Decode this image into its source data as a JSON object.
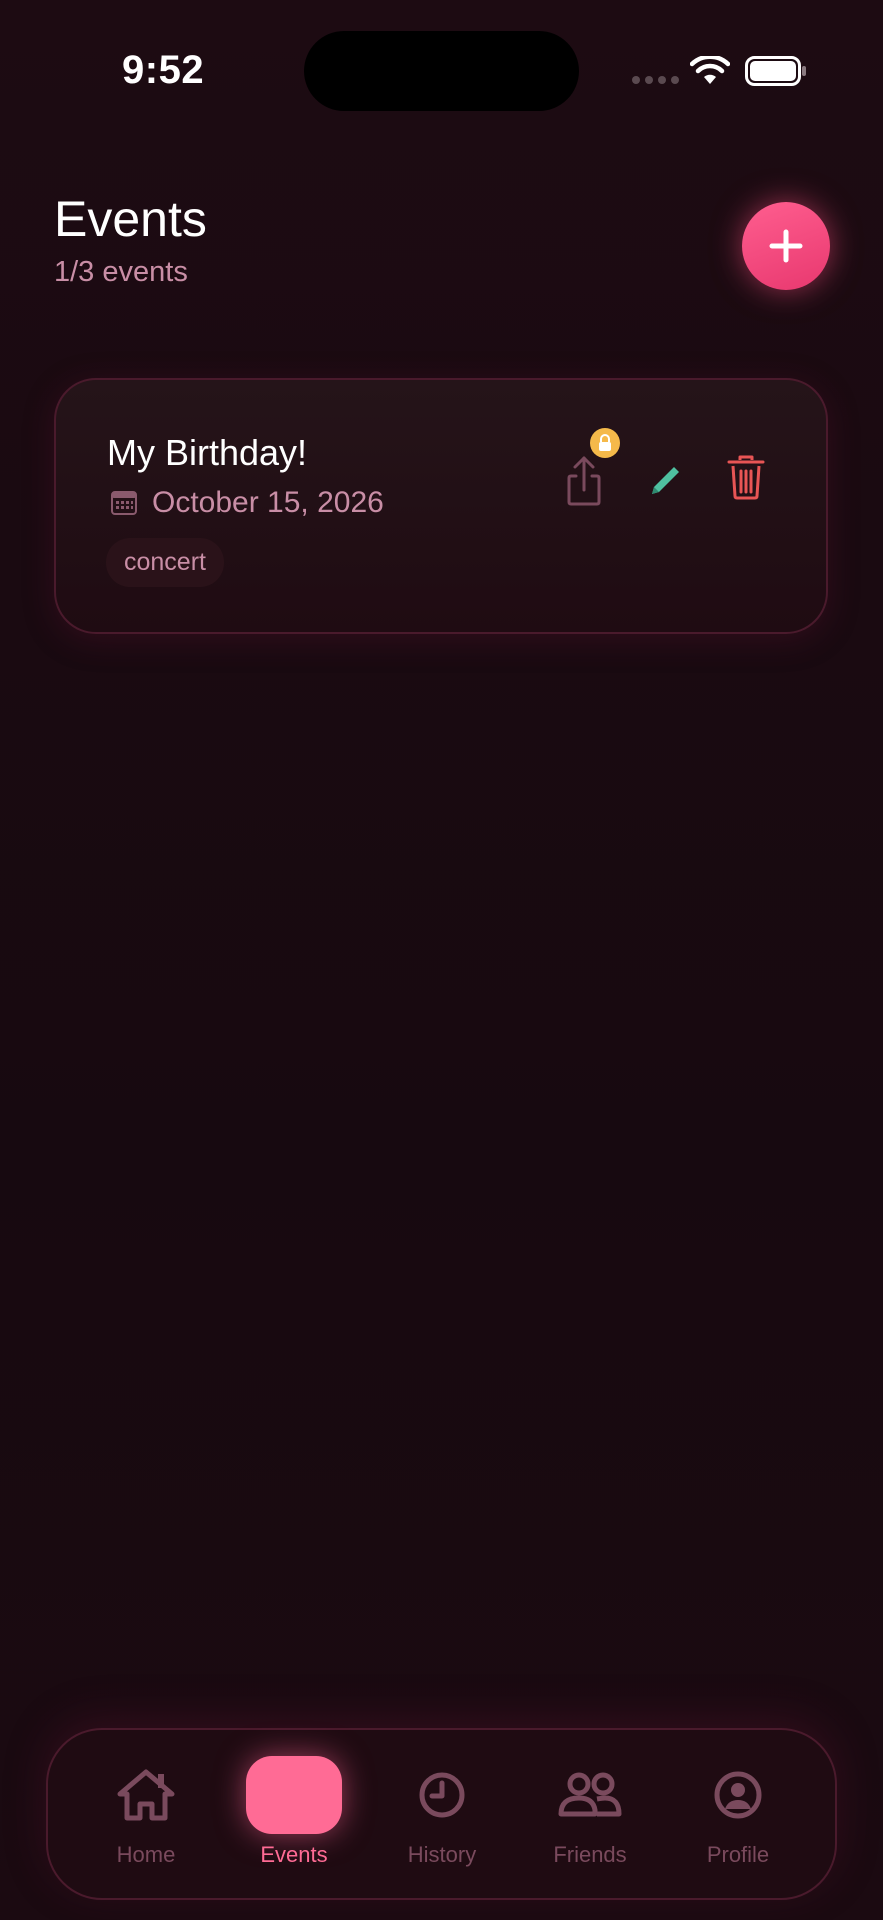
{
  "status": {
    "time": "9:52"
  },
  "header": {
    "title": "Events",
    "subtitle": "1/3 events",
    "add_icon": "plus-icon"
  },
  "events": [
    {
      "name": "My Birthday!",
      "date": "October 15, 2026",
      "tag": "concert",
      "actions": [
        "share-icon",
        "lock-icon",
        "pencil-icon",
        "trash-icon"
      ]
    }
  ],
  "tabs": [
    {
      "label": "Home",
      "icon": "home-icon",
      "active": false
    },
    {
      "label": "Events",
      "icon": "events-icon",
      "active": true
    },
    {
      "label": "History",
      "icon": "clock-icon",
      "active": false
    },
    {
      "label": "Friends",
      "icon": "friends-icon",
      "active": false
    },
    {
      "label": "Profile",
      "icon": "profile-icon",
      "active": false
    }
  ],
  "colors": {
    "background": "#1a0a10",
    "accent": "#ff6b95",
    "muted_text": "#c98ea6",
    "edit_icon": "#4fc0a0",
    "delete_icon": "#e85555",
    "lock_badge": "#f5b94a"
  }
}
